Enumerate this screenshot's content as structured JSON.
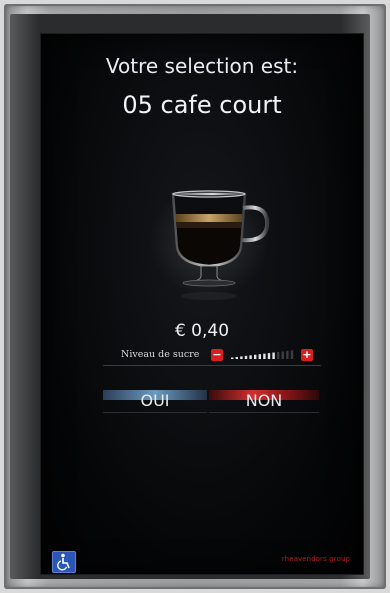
{
  "screen": {
    "title": "Votre selection est:",
    "product": "05 cafe court",
    "price": "€ 0,40"
  },
  "sugar": {
    "label": "Niveau de sucre",
    "minus_symbol": "−",
    "plus_symbol": "+",
    "level": 0.7
  },
  "buttons": {
    "yes_label": "OUI",
    "no_label": "NON"
  },
  "footer": {
    "brand": "rheavendors group",
    "accessibility_icon": "wheelchair-icon"
  },
  "colors": {
    "accent_red": "#d81e1e",
    "accent_blue": "#6c9ac0",
    "brand_red": "#b21d24"
  }
}
